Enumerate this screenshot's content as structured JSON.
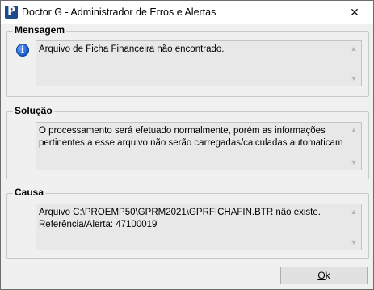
{
  "window": {
    "title": "Doctor G - Administrador de Erros e Alertas",
    "app_icon_letter": "P",
    "close_glyph": "✕"
  },
  "mensagem": {
    "label": "Mensagem",
    "icon": "info-icon",
    "icon_glyph": "i",
    "lines": [
      "Arquivo de Ficha Financeira não encontrado."
    ]
  },
  "solucao": {
    "label": "Solução",
    "lines": [
      "O processamento será efetuado normalmente, porém as informações",
      "pertinentes a esse arquivo não serão carregadas/calculadas automaticamente."
    ]
  },
  "causa": {
    "label": "Causa",
    "lines": [
      "Arquivo C:\\PROEMP50\\GPRM2021\\GPRFICHAFIN.BTR não existe.",
      "Referência/Alerta: 47100019"
    ]
  },
  "buttons": {
    "ok_first": "O",
    "ok_rest": "k"
  },
  "scroll": {
    "up_glyph": "▲",
    "down_glyph": "▼"
  }
}
